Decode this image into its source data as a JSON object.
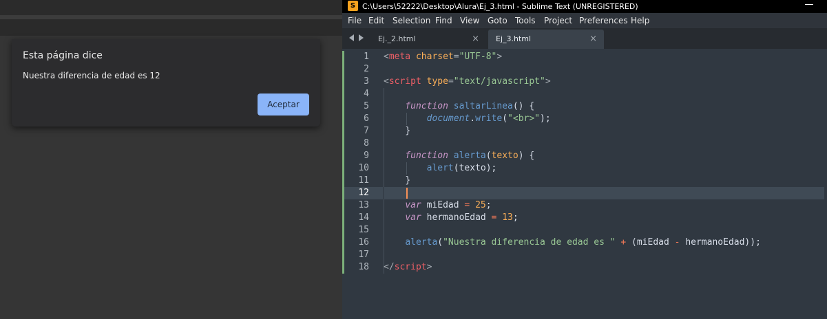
{
  "browser": {
    "dialog": {
      "title": "Esta página dice",
      "message": "Nuestra diferencia de edad es 12",
      "ok_label": "Aceptar"
    }
  },
  "sublime": {
    "window_title": "C:\\Users\\52222\\Desktop\\Alura\\Ej_3.html - Sublime Text (UNREGISTERED)",
    "app_icon_glyph": "S",
    "menu": [
      "File",
      "Edit",
      "Selection",
      "Find",
      "View",
      "Goto",
      "Tools",
      "Project",
      "Preferences",
      "Help"
    ],
    "tabs": [
      {
        "label": "Ej._2.html",
        "close": "×",
        "active": false
      },
      {
        "label": "Ej_3.html",
        "close": "×",
        "active": true
      }
    ],
    "line_numbers": [
      "1",
      "2",
      "3",
      "4",
      "5",
      "6",
      "7",
      "8",
      "9",
      "10",
      "11",
      "12",
      "13",
      "14",
      "15",
      "16",
      "17",
      "18"
    ],
    "current_line": 12,
    "code_lines": [
      [
        {
          "t": "<",
          "c": "t-punc"
        },
        {
          "t": "meta",
          "c": "t-tag"
        },
        {
          "t": " "
        },
        {
          "t": "charset",
          "c": "t-attr"
        },
        {
          "t": "=",
          "c": "t-punc"
        },
        {
          "t": "\"UTF-8\"",
          "c": "t-str"
        },
        {
          "t": ">",
          "c": "t-punc"
        }
      ],
      [],
      [
        {
          "t": "<",
          "c": "t-punc"
        },
        {
          "t": "script",
          "c": "t-tag"
        },
        {
          "t": " "
        },
        {
          "t": "type",
          "c": "t-attr"
        },
        {
          "t": "=",
          "c": "t-punc"
        },
        {
          "t": "\"text/javascript\"",
          "c": "t-str"
        },
        {
          "t": ">",
          "c": "t-punc"
        }
      ],
      [],
      [
        {
          "t": "    "
        },
        {
          "t": "function",
          "c": "t-kw"
        },
        {
          "t": " "
        },
        {
          "t": "saltarLinea",
          "c": "t-fn"
        },
        {
          "t": "() {",
          "c": "t-id"
        }
      ],
      [
        {
          "t": "        "
        },
        {
          "t": "document",
          "c": "t-obj"
        },
        {
          "t": ".",
          "c": "t-id"
        },
        {
          "t": "write",
          "c": "t-fn"
        },
        {
          "t": "(",
          "c": "t-id"
        },
        {
          "t": "\"<br>\"",
          "c": "t-str"
        },
        {
          "t": ");",
          "c": "t-id"
        }
      ],
      [
        {
          "t": "    "
        },
        {
          "t": "}",
          "c": "t-id"
        }
      ],
      [],
      [
        {
          "t": "    "
        },
        {
          "t": "function",
          "c": "t-kw"
        },
        {
          "t": " "
        },
        {
          "t": "alerta",
          "c": "t-fn"
        },
        {
          "t": "(",
          "c": "t-id"
        },
        {
          "t": "texto",
          "c": "t-param"
        },
        {
          "t": ") {",
          "c": "t-id"
        }
      ],
      [
        {
          "t": "        "
        },
        {
          "t": "alert",
          "c": "t-fn"
        },
        {
          "t": "(texto);",
          "c": "t-id"
        }
      ],
      [
        {
          "t": "    "
        },
        {
          "t": "}",
          "c": "t-id"
        }
      ],
      [],
      [
        {
          "t": "    "
        },
        {
          "t": "var",
          "c": "t-kw"
        },
        {
          "t": " miEdad ",
          "c": "t-id"
        },
        {
          "t": "=",
          "c": "t-op"
        },
        {
          "t": " "
        },
        {
          "t": "25",
          "c": "t-num"
        },
        {
          "t": ";",
          "c": "t-id"
        }
      ],
      [
        {
          "t": "    "
        },
        {
          "t": "var",
          "c": "t-kw"
        },
        {
          "t": " hermanoEdad ",
          "c": "t-id"
        },
        {
          "t": "=",
          "c": "t-op"
        },
        {
          "t": " "
        },
        {
          "t": "13",
          "c": "t-num"
        },
        {
          "t": ";",
          "c": "t-id"
        }
      ],
      [],
      [
        {
          "t": "    "
        },
        {
          "t": "alerta",
          "c": "t-fn"
        },
        {
          "t": "(",
          "c": "t-id"
        },
        {
          "t": "\"Nuestra diferencia de edad es \"",
          "c": "t-str"
        },
        {
          "t": " "
        },
        {
          "t": "+",
          "c": "t-op"
        },
        {
          "t": " (miEdad ",
          "c": "t-id"
        },
        {
          "t": "-",
          "c": "t-op"
        },
        {
          "t": " hermanoEdad));",
          "c": "t-id"
        }
      ],
      [],
      [
        {
          "t": "</",
          "c": "t-punc"
        },
        {
          "t": "script",
          "c": "t-tag"
        },
        {
          "t": ">",
          "c": "t-punc"
        }
      ]
    ],
    "colors": {
      "editor_bg": "#303841",
      "tag": "#ec5f66",
      "string": "#99c794",
      "keyword": "#c695c6",
      "function": "#6699cc",
      "number": "#f9ae58",
      "caret": "#f99157"
    }
  }
}
